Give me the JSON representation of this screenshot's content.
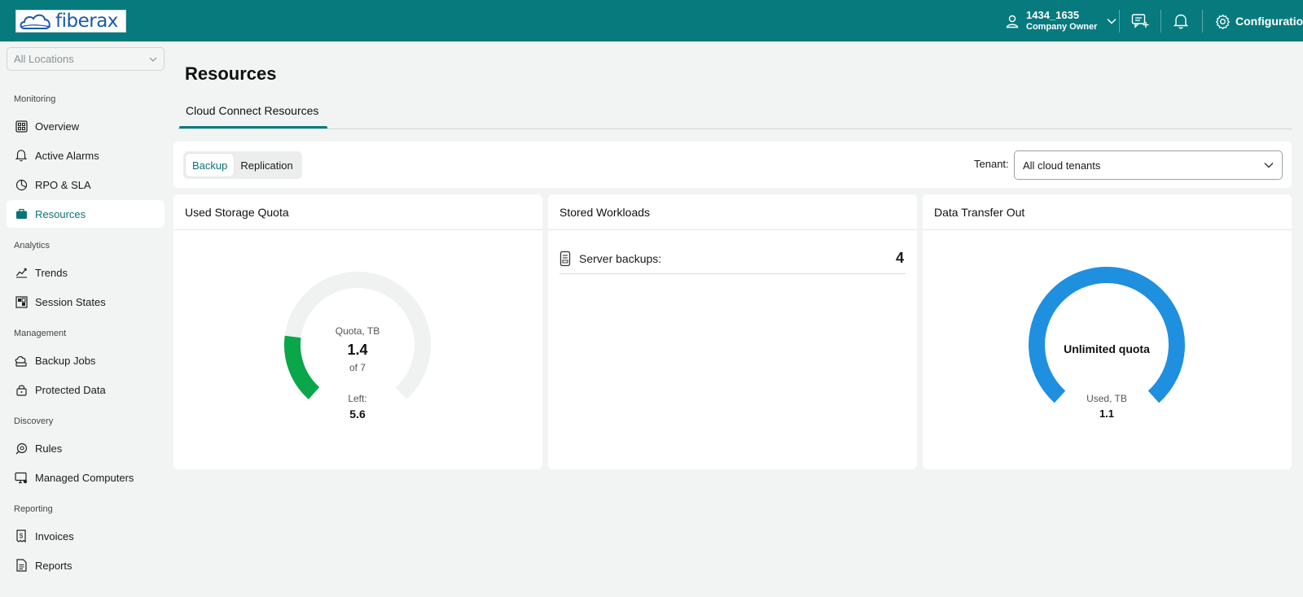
{
  "header": {
    "logo_text": "fiberax",
    "user_name": "1434_1635",
    "user_role": "Company Owner",
    "configuration_label": "Configuration",
    "brand_color": "#077a7e"
  },
  "sidebar": {
    "location_select": "All Locations",
    "sections": [
      {
        "title": "Monitoring",
        "items": [
          {
            "label": "Overview",
            "icon": "dashboard-icon"
          },
          {
            "label": "Active Alarms",
            "icon": "bell-icon"
          },
          {
            "label": "RPO & SLA",
            "icon": "pie-chart-icon"
          },
          {
            "label": "Resources",
            "icon": "briefcase-icon",
            "active": true
          }
        ]
      },
      {
        "title": "Analytics",
        "items": [
          {
            "label": "Trends",
            "icon": "trend-icon"
          },
          {
            "label": "Session States",
            "icon": "grid-icon"
          }
        ]
      },
      {
        "title": "Management",
        "items": [
          {
            "label": "Backup Jobs",
            "icon": "backup-jobs-icon"
          },
          {
            "label": "Protected Data",
            "icon": "lock-icon"
          }
        ]
      },
      {
        "title": "Discovery",
        "items": [
          {
            "label": "Rules",
            "icon": "rules-icon"
          },
          {
            "label": "Managed Computers",
            "icon": "computer-icon"
          }
        ]
      },
      {
        "title": "Reporting",
        "items": [
          {
            "label": "Invoices",
            "icon": "invoice-icon"
          },
          {
            "label": "Reports",
            "icon": "report-icon"
          }
        ]
      }
    ]
  },
  "main": {
    "title": "Resources",
    "tab": "Cloud Connect Resources",
    "segments": [
      "Backup",
      "Replication"
    ],
    "active_segment": "Backup",
    "tenant_label": "Tenant:",
    "tenant_value": "All cloud tenants"
  },
  "cards": {
    "storage": {
      "title": "Used Storage Quota",
      "gauge_label": "Quota, TB",
      "used": "1.4",
      "of_text": "of 7",
      "left_label": "Left:",
      "left_value": "5.6",
      "used_fraction": 0.2,
      "color": "#0aa64a"
    },
    "workloads": {
      "title": "Stored Workloads",
      "row_label": "Server backups:",
      "row_value": "4"
    },
    "transfer": {
      "title": "Data Transfer Out",
      "center_label": "Unlimited quota",
      "used_label": "Used, TB",
      "used_value": "1.1",
      "color": "#1f8fe0"
    }
  }
}
